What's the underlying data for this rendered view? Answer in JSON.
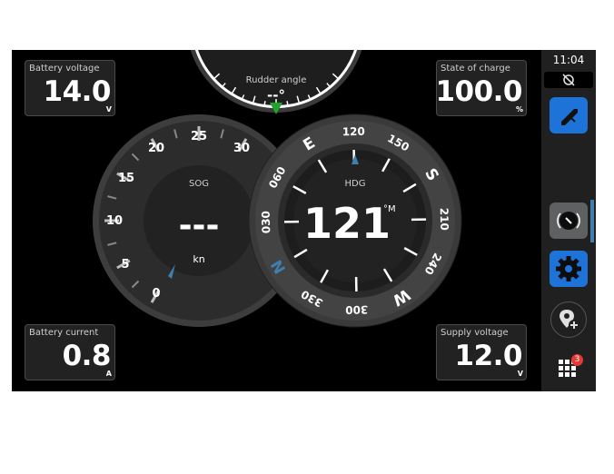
{
  "tiles": {
    "battery_voltage": {
      "label": "Battery voltage",
      "value": "14.0",
      "unit": "V"
    },
    "state_of_charge": {
      "label": "State of charge",
      "value": "100.0",
      "unit": "%"
    },
    "battery_current": {
      "label": "Battery current",
      "value": "0.8",
      "unit": "A"
    },
    "supply_voltage": {
      "label": "Supply voltage",
      "value": "12.0",
      "unit": "V"
    }
  },
  "rudder": {
    "label": "Rudder angle",
    "value": "--°",
    "indicator_color": "#1fa22e"
  },
  "sog": {
    "label": "SOG",
    "value": "---",
    "unit": "kn",
    "scale_labels": [
      "0",
      "5",
      "10",
      "15",
      "20",
      "25",
      "30"
    ]
  },
  "heading": {
    "label": "HDG",
    "value": "121",
    "unit": "°M",
    "compass_labels": [
      "E",
      "120",
      "150",
      "S",
      "210",
      "240",
      "W",
      "300",
      "330",
      "N",
      "030",
      "060"
    ]
  },
  "sidebar": {
    "time": "11:04",
    "status_icon": "link-off-icon",
    "chart_button_icon": "chart-plotter-icon",
    "autopilot_button_icon": "autopilot-icon",
    "settings_button_icon": "gear-icon",
    "waypoint_button_icon": "add-waypoint-icon",
    "apps_button_icon": "apps-grid-icon",
    "apps_badge": "3"
  },
  "colors": {
    "accent_blue": "#1e73d8",
    "needle_blue": "#3f7fae",
    "background": "#000000",
    "tile_bg": "#222223"
  }
}
